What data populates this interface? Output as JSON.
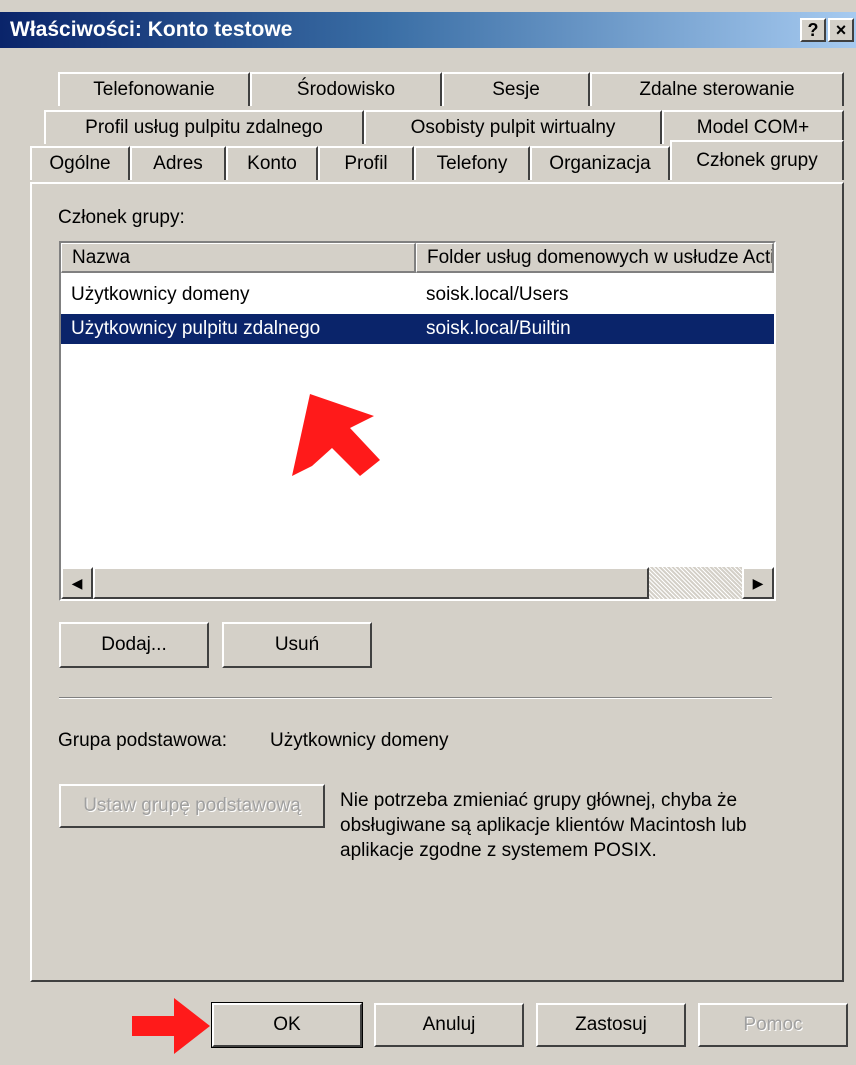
{
  "window": {
    "title": "Właściwości: Konto testowe",
    "help_glyph": "?",
    "close_glyph": "×"
  },
  "tabs": {
    "row1": [
      "Telefonowanie",
      "Środowisko",
      "Sesje",
      "Zdalne sterowanie"
    ],
    "row2": [
      "Profil usług pulpitu zdalnego",
      "Osobisty pulpit wirtualny",
      "Model COM+"
    ],
    "row3": [
      "Ogólne",
      "Adres",
      "Konto",
      "Profil",
      "Telefony",
      "Organizacja",
      "Członek grupy"
    ],
    "active": "Członek grupy"
  },
  "members": {
    "label": "Członek grupy:",
    "columns": [
      "Nazwa",
      "Folder usług domenowych w usłudze Active Directory"
    ],
    "rows": [
      {
        "name": "Użytkownicy domeny",
        "folder": "soisk.local/Users",
        "selected": false
      },
      {
        "name": "Użytkownicy pulpitu zdalnego",
        "folder": "soisk.local/Builtin",
        "selected": true
      }
    ],
    "scroll_left_glyph": "◀",
    "scroll_right_glyph": "▶"
  },
  "buttons": {
    "add": "Dodaj...",
    "remove": "Usuń",
    "set_primary": "Ustaw grupę podstawową",
    "ok": "OK",
    "cancel": "Anuluj",
    "apply": "Zastosuj",
    "help": "Pomoc"
  },
  "primary_group": {
    "label": "Grupa podstawowa:",
    "value": "Użytkownicy domeny",
    "description": "Nie potrzeba zmieniać grupy głównej, chyba że obsługiwane są aplikacje klientów Macintosh lub aplikacje zgodne z systemem POSIX."
  },
  "colors": {
    "titlebar_start": "#0a246a",
    "titlebar_end": "#a6caf0",
    "dialog_bg": "#d4d0c8",
    "selection": "#0a246a",
    "annotation_arrow": "#ff1a1a"
  },
  "icons": [
    "help-icon",
    "close-icon",
    "scroll-left-icon",
    "scroll-right-icon",
    "annotation-arrow-icon"
  ]
}
